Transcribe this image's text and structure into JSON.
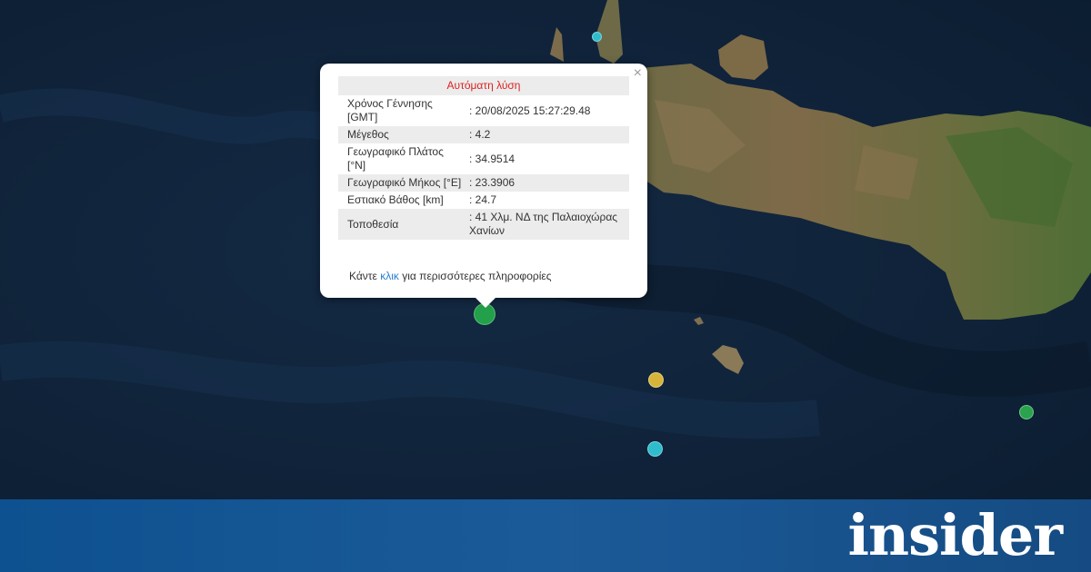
{
  "popup": {
    "header": "Αυτόματη λύση",
    "close_symbol": "×",
    "rows": [
      {
        "label": "Χρόνος Γέννησης [GMT]",
        "value": ": 20/08/2025 15:27:29.48"
      },
      {
        "label": "Μέγεθος",
        "value": ": 4.2"
      },
      {
        "label": "Γεωγραφικό Πλάτος [°N]",
        "value": ": 34.9514"
      },
      {
        "label": "Γεωγραφικό Μήκος [°E]",
        "value": ": 23.3906"
      },
      {
        "label": "Εστιακό Βάθος [km]",
        "value": ": 24.7"
      },
      {
        "label": "Τοποθεσία",
        "value": ": 41 Χλμ. ΝΔ της Παλαιοχώρας Χανίων"
      }
    ],
    "more_prefix": "Κάντε ",
    "more_link": "κλικ",
    "more_suffix": " για περισσότερες πληροφορίες"
  },
  "markers": [
    {
      "name": "earthquake-marker-selected",
      "color": "#23a04a"
    },
    {
      "name": "earthquake-marker-yellow",
      "color": "#d6b43a"
    },
    {
      "name": "earthquake-marker-cyan",
      "color": "#2fbccd"
    },
    {
      "name": "earthquake-marker-cyan-north",
      "color": "#2fbccd"
    },
    {
      "name": "earthquake-marker-green-east",
      "color": "#2aa24e"
    }
  ],
  "brand": {
    "logo_text": "insider"
  }
}
